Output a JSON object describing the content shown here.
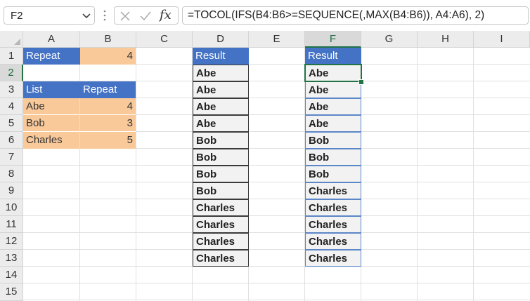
{
  "formula_bar": {
    "name_box": "F2",
    "formula": "=TOCOL(IFS(B4:B6>=SEQUENCE(,MAX(B4:B6)), A4:A6), 2)",
    "fx_label": "fx"
  },
  "columns": [
    "A",
    "B",
    "C",
    "D",
    "E",
    "F",
    "G",
    "H",
    "I"
  ],
  "rows": [
    "1",
    "2",
    "3",
    "4",
    "5",
    "6",
    "7",
    "8",
    "9",
    "10",
    "11",
    "12",
    "13",
    "14",
    "15"
  ],
  "selected_column": "F",
  "selected_row": "2",
  "cells": {
    "A1": "Repeat",
    "B1": "4",
    "A3": "List",
    "B3": "Repeat",
    "A4": "Abe",
    "B4": "4",
    "A5": "Bob",
    "B5": "3",
    "A6": "Charles",
    "B6": "5",
    "D1": "Result",
    "F1": "Result"
  },
  "d_results": [
    "Abe",
    "Abe",
    "Abe",
    "Abe",
    "Bob",
    "Bob",
    "Bob",
    "Bob",
    "Charles",
    "Charles",
    "Charles",
    "Charles"
  ],
  "f_results": [
    "Abe",
    "Abe",
    "Abe",
    "Abe",
    "Bob",
    "Bob",
    "Bob",
    "Charles",
    "Charles",
    "Charles",
    "Charles",
    "Charles"
  ],
  "colors": {
    "header_blue": "#4472c4",
    "orange": "#f9c99a",
    "selection_green": "#217346"
  }
}
